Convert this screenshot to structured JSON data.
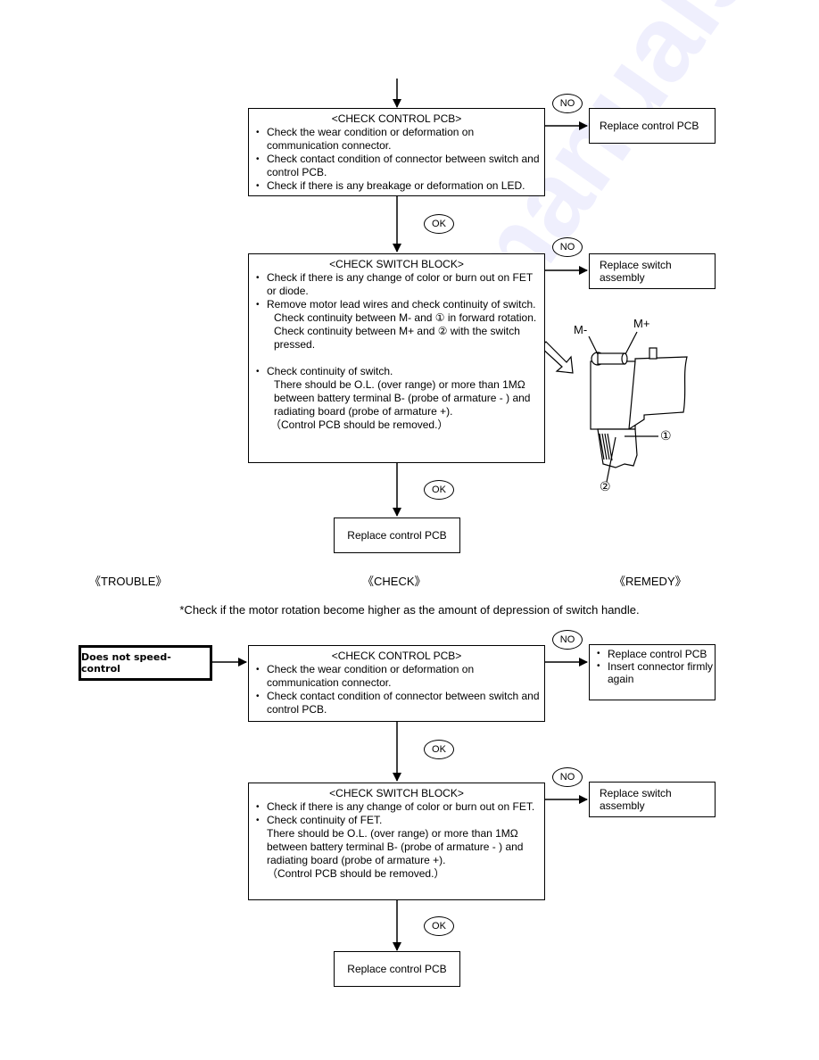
{
  "section1": {
    "check_control_pcb": {
      "title": "<CHECK CONTROL PCB>",
      "items": [
        "Check the wear condition or deformation on communication connector.",
        "Check contact condition of connector between switch and control PCB.",
        "Check if there is any breakage or deformation on LED."
      ]
    },
    "no_label_1": "NO",
    "remedy_1": "Replace control PCB",
    "ok_label_1": "OK",
    "check_switch_block": {
      "title": "<CHECK SWITCH BLOCK>",
      "item1": "Check if there is any change of color or burn out on FET or diode.",
      "item2": "Remove motor lead wires and check continuity of switch.",
      "item2_sub1": "Check continuity between M- and ① in forward rotation.",
      "item2_sub2": "Check continuity between M+ and ② with the switch pressed.",
      "item3": "Check continuity of switch.",
      "item3_sub1": "There should be O.L. (over range) or more than 1MΩ  between battery terminal B- (probe of armature - ) and radiating board (probe of armature +).",
      "item3_sub2": "（Control PCB should be removed.）"
    },
    "no_label_2": "NO",
    "remedy_2": "Replace switch assembly",
    "ok_label_2": "OK",
    "final_remedy": "Replace control PCB",
    "figure": {
      "label_m_minus": "M-",
      "label_m_plus": "M+",
      "label_1": "①",
      "label_2": "②"
    }
  },
  "headers": {
    "trouble": "《TROUBLE》",
    "check": "《CHECK》",
    "remedy": "《REMEDY》"
  },
  "note": "*Check if the motor rotation become higher as the amount of depression of switch handle.",
  "section2": {
    "trouble": "Does not speed-control",
    "check_control_pcb": {
      "title": "<CHECK CONTROL PCB>",
      "items": [
        "Check the wear condition or deformation on communication connector.",
        "Check contact condition of connector between switch and control PCB."
      ]
    },
    "no_label_1": "NO",
    "remedy_1": {
      "items": [
        "Replace control PCB",
        "Insert connector firmly again"
      ]
    },
    "ok_label_1": "OK",
    "check_switch_block": {
      "title": "<CHECK SWITCH BLOCK>",
      "item1": "Check if there is any change of color or burn out on FET.",
      "item2": "Check continuity of FET.",
      "item2_sub1": "There should be O.L. (over range) or more than 1MΩ between battery terminal B- (probe of armature - ) and radiating board (probe of armature +).",
      "item2_sub2": "（Control PCB should be removed.）"
    },
    "no_label_2": "NO",
    "remedy_2": "Replace switch assembly",
    "ok_label_2": "OK",
    "final_remedy": "Replace control PCB"
  },
  "watermark": "manualsarchive.com"
}
